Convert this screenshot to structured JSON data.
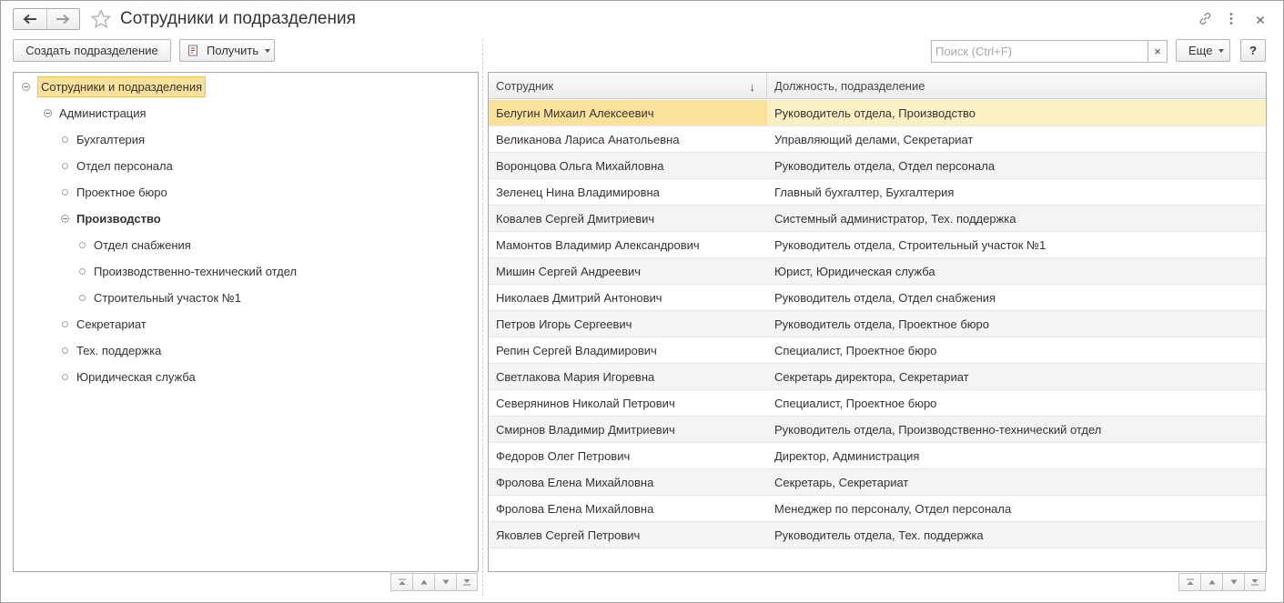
{
  "window": {
    "title": "Сотрудники и подразделения"
  },
  "toolbar": {
    "create_label": "Создать подразделение",
    "get_label": "Получить",
    "search_placeholder": "Поиск (Ctrl+F)",
    "search_clear": "×",
    "more_label": "Еще",
    "help_label": "?"
  },
  "tree": {
    "items": [
      {
        "label": "Сотрудники и подразделения",
        "level": 0,
        "node": "collapse",
        "selected": true,
        "bold": false
      },
      {
        "label": "Администрация",
        "level": 1,
        "node": "collapse",
        "selected": false,
        "bold": false
      },
      {
        "label": "Бухгалтерия",
        "level": 2,
        "node": "leaf",
        "selected": false,
        "bold": false
      },
      {
        "label": "Отдел персонала",
        "level": 2,
        "node": "leaf",
        "selected": false,
        "bold": false
      },
      {
        "label": "Проектное бюро",
        "level": 2,
        "node": "leaf",
        "selected": false,
        "bold": false
      },
      {
        "label": "Производство",
        "level": 2,
        "node": "collapse",
        "selected": false,
        "bold": true
      },
      {
        "label": "Отдел снабжения",
        "level": 3,
        "node": "leaf",
        "selected": false,
        "bold": false
      },
      {
        "label": "Производственно-технический отдел",
        "level": 3,
        "node": "leaf",
        "selected": false,
        "bold": false
      },
      {
        "label": "Строительный участок №1",
        "level": 3,
        "node": "leaf",
        "selected": false,
        "bold": false
      },
      {
        "label": "Секретариат",
        "level": 2,
        "node": "leaf",
        "selected": false,
        "bold": false
      },
      {
        "label": "Тех. поддержка",
        "level": 2,
        "node": "leaf",
        "selected": false,
        "bold": false
      },
      {
        "label": "Юридическая служба",
        "level": 2,
        "node": "leaf",
        "selected": false,
        "bold": false
      }
    ]
  },
  "table": {
    "columns": [
      "Сотрудник",
      "Должность, подразделение"
    ],
    "sort_indicator": "↓",
    "rows": [
      {
        "employee": "Белугин Михаил Алексеевич",
        "position": "Руководитель отдела, Производство",
        "selected": true
      },
      {
        "employee": "Великанова Лариса Анатольевна",
        "position": "Управляющий делами, Секретариат",
        "selected": false
      },
      {
        "employee": "Воронцова Ольга Михайловна",
        "position": "Руководитель отдела, Отдел персонала",
        "selected": false
      },
      {
        "employee": "Зеленец Нина Владимировна",
        "position": "Главный бухгалтер, Бухгалтерия",
        "selected": false
      },
      {
        "employee": "Ковалев Сергей Дмитриевич",
        "position": "Системный администратор, Тех. поддержка",
        "selected": false
      },
      {
        "employee": "Мамонтов Владимир Александрович",
        "position": "Руководитель отдела, Строительный участок №1",
        "selected": false
      },
      {
        "employee": "Мишин Сергей Андреевич",
        "position": "Юрист, Юридическая служба",
        "selected": false
      },
      {
        "employee": "Николаев Дмитрий Антонович",
        "position": "Руководитель отдела, Отдел снабжения",
        "selected": false
      },
      {
        "employee": "Петров Игорь Сергеевич",
        "position": "Руководитель отдела, Проектное бюро",
        "selected": false
      },
      {
        "employee": "Репин Сергей Владимирович",
        "position": "Специалист, Проектное бюро",
        "selected": false
      },
      {
        "employee": "Светлакова Мария Игоревна",
        "position": "Секретарь директора, Секретариат",
        "selected": false
      },
      {
        "employee": "Северянинов Николай Петрович",
        "position": "Специалист, Проектное бюро",
        "selected": false
      },
      {
        "employee": "Смирнов Владимир Дмитриевич",
        "position": "Руководитель отдела, Производственно-технический отдел",
        "selected": false
      },
      {
        "employee": "Федоров Олег Петрович",
        "position": "Директор, Администрация",
        "selected": false
      },
      {
        "employee": "Фролова Елена Михайловна",
        "position": "Секретарь, Секретариат",
        "selected": false
      },
      {
        "employee": "Фролова Елена Михайловна",
        "position": "Менеджер по персоналу, Отдел персонала",
        "selected": false
      },
      {
        "employee": "Яковлев Сергей Петрович",
        "position": "Руководитель отдела, Тех. поддержка",
        "selected": false
      }
    ]
  },
  "colors": {
    "selection": "#fbe19a",
    "selection_border": "#f3c13a",
    "row_selected": "#fbf0c4",
    "row_alt": "#f4f4f4"
  }
}
